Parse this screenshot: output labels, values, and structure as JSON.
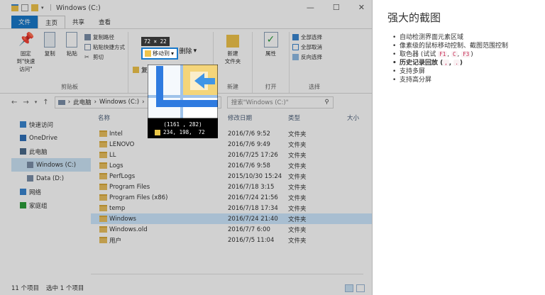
{
  "explorer": {
    "title": "Windows (C:)",
    "tabs": [
      "文件",
      "主页",
      "共享",
      "查看"
    ],
    "ribbon": {
      "pin_label": "固定到\"快速访问\"",
      "copy_label": "复制",
      "paste_label": "粘贴",
      "copy_path_label": "复制路径",
      "paste_shortcut_label": "粘贴快捷方式",
      "cut_label": "剪切",
      "clipboard_group": "剪贴板",
      "move_to_label": "移动到",
      "delete_label": "删除",
      "copy_to_label": "复制到",
      "new_folder_label": "新建\n文件夹",
      "new_group": "新建",
      "properties_label": "属性",
      "open_group": "打开",
      "select_all_label": "全部选择",
      "select_none_label": "全部取消",
      "invert_selection_label": "反向选择",
      "select_group": "选择"
    },
    "address": {
      "crumbs": [
        "此电脑",
        "Windows (C:)"
      ],
      "search_placeholder": "搜索\"Windows (C:)\""
    },
    "nav": [
      {
        "label": "快速访问",
        "selected": false,
        "child": false
      },
      {
        "label": "OneDrive",
        "selected": false,
        "child": false
      },
      {
        "label": "此电脑",
        "selected": false,
        "child": false
      },
      {
        "label": "Windows (C:)",
        "selected": true,
        "child": true
      },
      {
        "label": "Data (D:)",
        "selected": false,
        "child": true
      },
      {
        "label": "网络",
        "selected": false,
        "child": false
      },
      {
        "label": "家庭组",
        "selected": false,
        "child": false
      }
    ],
    "columns": {
      "name": "名称",
      "date": "修改日期",
      "type": "类型",
      "size": "大小"
    },
    "files": [
      {
        "name": "Intel",
        "date": "2016/7/6 9:52",
        "type": "文件夹"
      },
      {
        "name": "LENOVO",
        "date": "2016/7/6 9:49",
        "type": "文件夹"
      },
      {
        "name": "LL",
        "date": "2016/7/25 17:26",
        "type": "文件夹"
      },
      {
        "name": "Logs",
        "date": "2016/7/6 9:58",
        "type": "文件夹"
      },
      {
        "name": "PerfLogs",
        "date": "2015/10/30 15:24",
        "type": "文件夹"
      },
      {
        "name": "Program Files",
        "date": "2016/7/18 3:15",
        "type": "文件夹"
      },
      {
        "name": "Program Files (x86)",
        "date": "2016/7/24 21:56",
        "type": "文件夹"
      },
      {
        "name": "temp",
        "date": "2016/7/18 17:34",
        "type": "文件夹"
      },
      {
        "name": "Windows",
        "date": "2016/7/24 21:40",
        "type": "文件夹",
        "selected": true
      },
      {
        "name": "Windows.old",
        "date": "2016/7/7 6:00",
        "type": "文件夹"
      },
      {
        "name": "用户",
        "date": "2016/7/5 11:04",
        "type": "文件夹"
      }
    ],
    "status": {
      "count": "11 个项目",
      "selected": "选中 1 个项目"
    }
  },
  "capture": {
    "size_label": "72 × 22",
    "coords": "(1161 , 282)",
    "rgb": "234, 198,  72",
    "swatch_color": "#eac648"
  },
  "description": {
    "title": "强大的截图",
    "items": [
      {
        "text": "自动检测界面元素区域"
      },
      {
        "text": "像素级的鼠标移动控制、截图范围控制"
      },
      {
        "prefix": "取色器 (试试 ",
        "keys": [
          "F1",
          "C",
          "F3"
        ],
        "suffix": ")"
      },
      {
        "prefix": "历史记录回放 (",
        "keys": [
          ",",
          "."
        ],
        "suffix": ")",
        "bold": true
      },
      {
        "text": "支持多屏"
      },
      {
        "text": "支持高分屏"
      }
    ]
  }
}
